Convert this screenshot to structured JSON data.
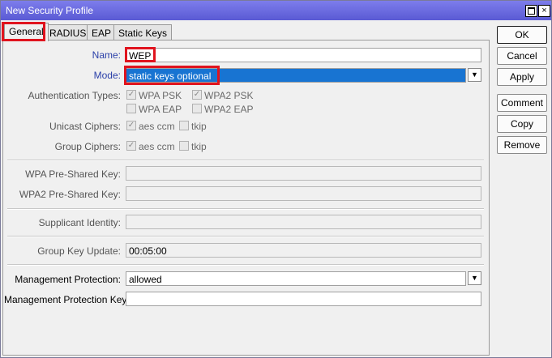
{
  "window": {
    "title": "New Security Profile",
    "maximize_glyph": "",
    "close_glyph": "×"
  },
  "tabs": [
    {
      "label": "General"
    },
    {
      "label": "RADIUS"
    },
    {
      "label": "EAP"
    },
    {
      "label": "Static Keys"
    }
  ],
  "form": {
    "name_label": "Name:",
    "name_value": "WEP",
    "mode_label": "Mode:",
    "mode_value": "static keys optional",
    "auth_types_label": "Authentication Types:",
    "auth_options": {
      "wpa_psk": "WPA PSK",
      "wpa2_psk": "WPA2 PSK",
      "wpa_eap": "WPA EAP",
      "wpa2_eap": "WPA2 EAP"
    },
    "unicast_label": "Unicast Ciphers:",
    "group_label": "Group Ciphers:",
    "cipher_aes": "aes ccm",
    "cipher_tkip": "tkip",
    "wpa_psk_label": "WPA Pre-Shared Key:",
    "wpa2_psk_label": "WPA2 Pre-Shared Key:",
    "supplicant_label": "Supplicant Identity:",
    "group_key_update_label": "Group Key Update:",
    "group_key_update_value": "00:05:00",
    "mgmt_protection_label": "Management Protection:",
    "mgmt_protection_value": "allowed",
    "mgmt_protection_key_label": "Management Protection Key:"
  },
  "buttons": {
    "ok": "OK",
    "cancel": "Cancel",
    "apply": "Apply",
    "comment": "Comment",
    "copy": "Copy",
    "remove": "Remove"
  },
  "icons": {
    "dropdown": "▼",
    "check": "✓"
  },
  "colors": {
    "titlebar": "#6b6be0",
    "selection": "#1874d2",
    "highlight": "#e0141e",
    "label_blue": "#2a3fa8"
  }
}
